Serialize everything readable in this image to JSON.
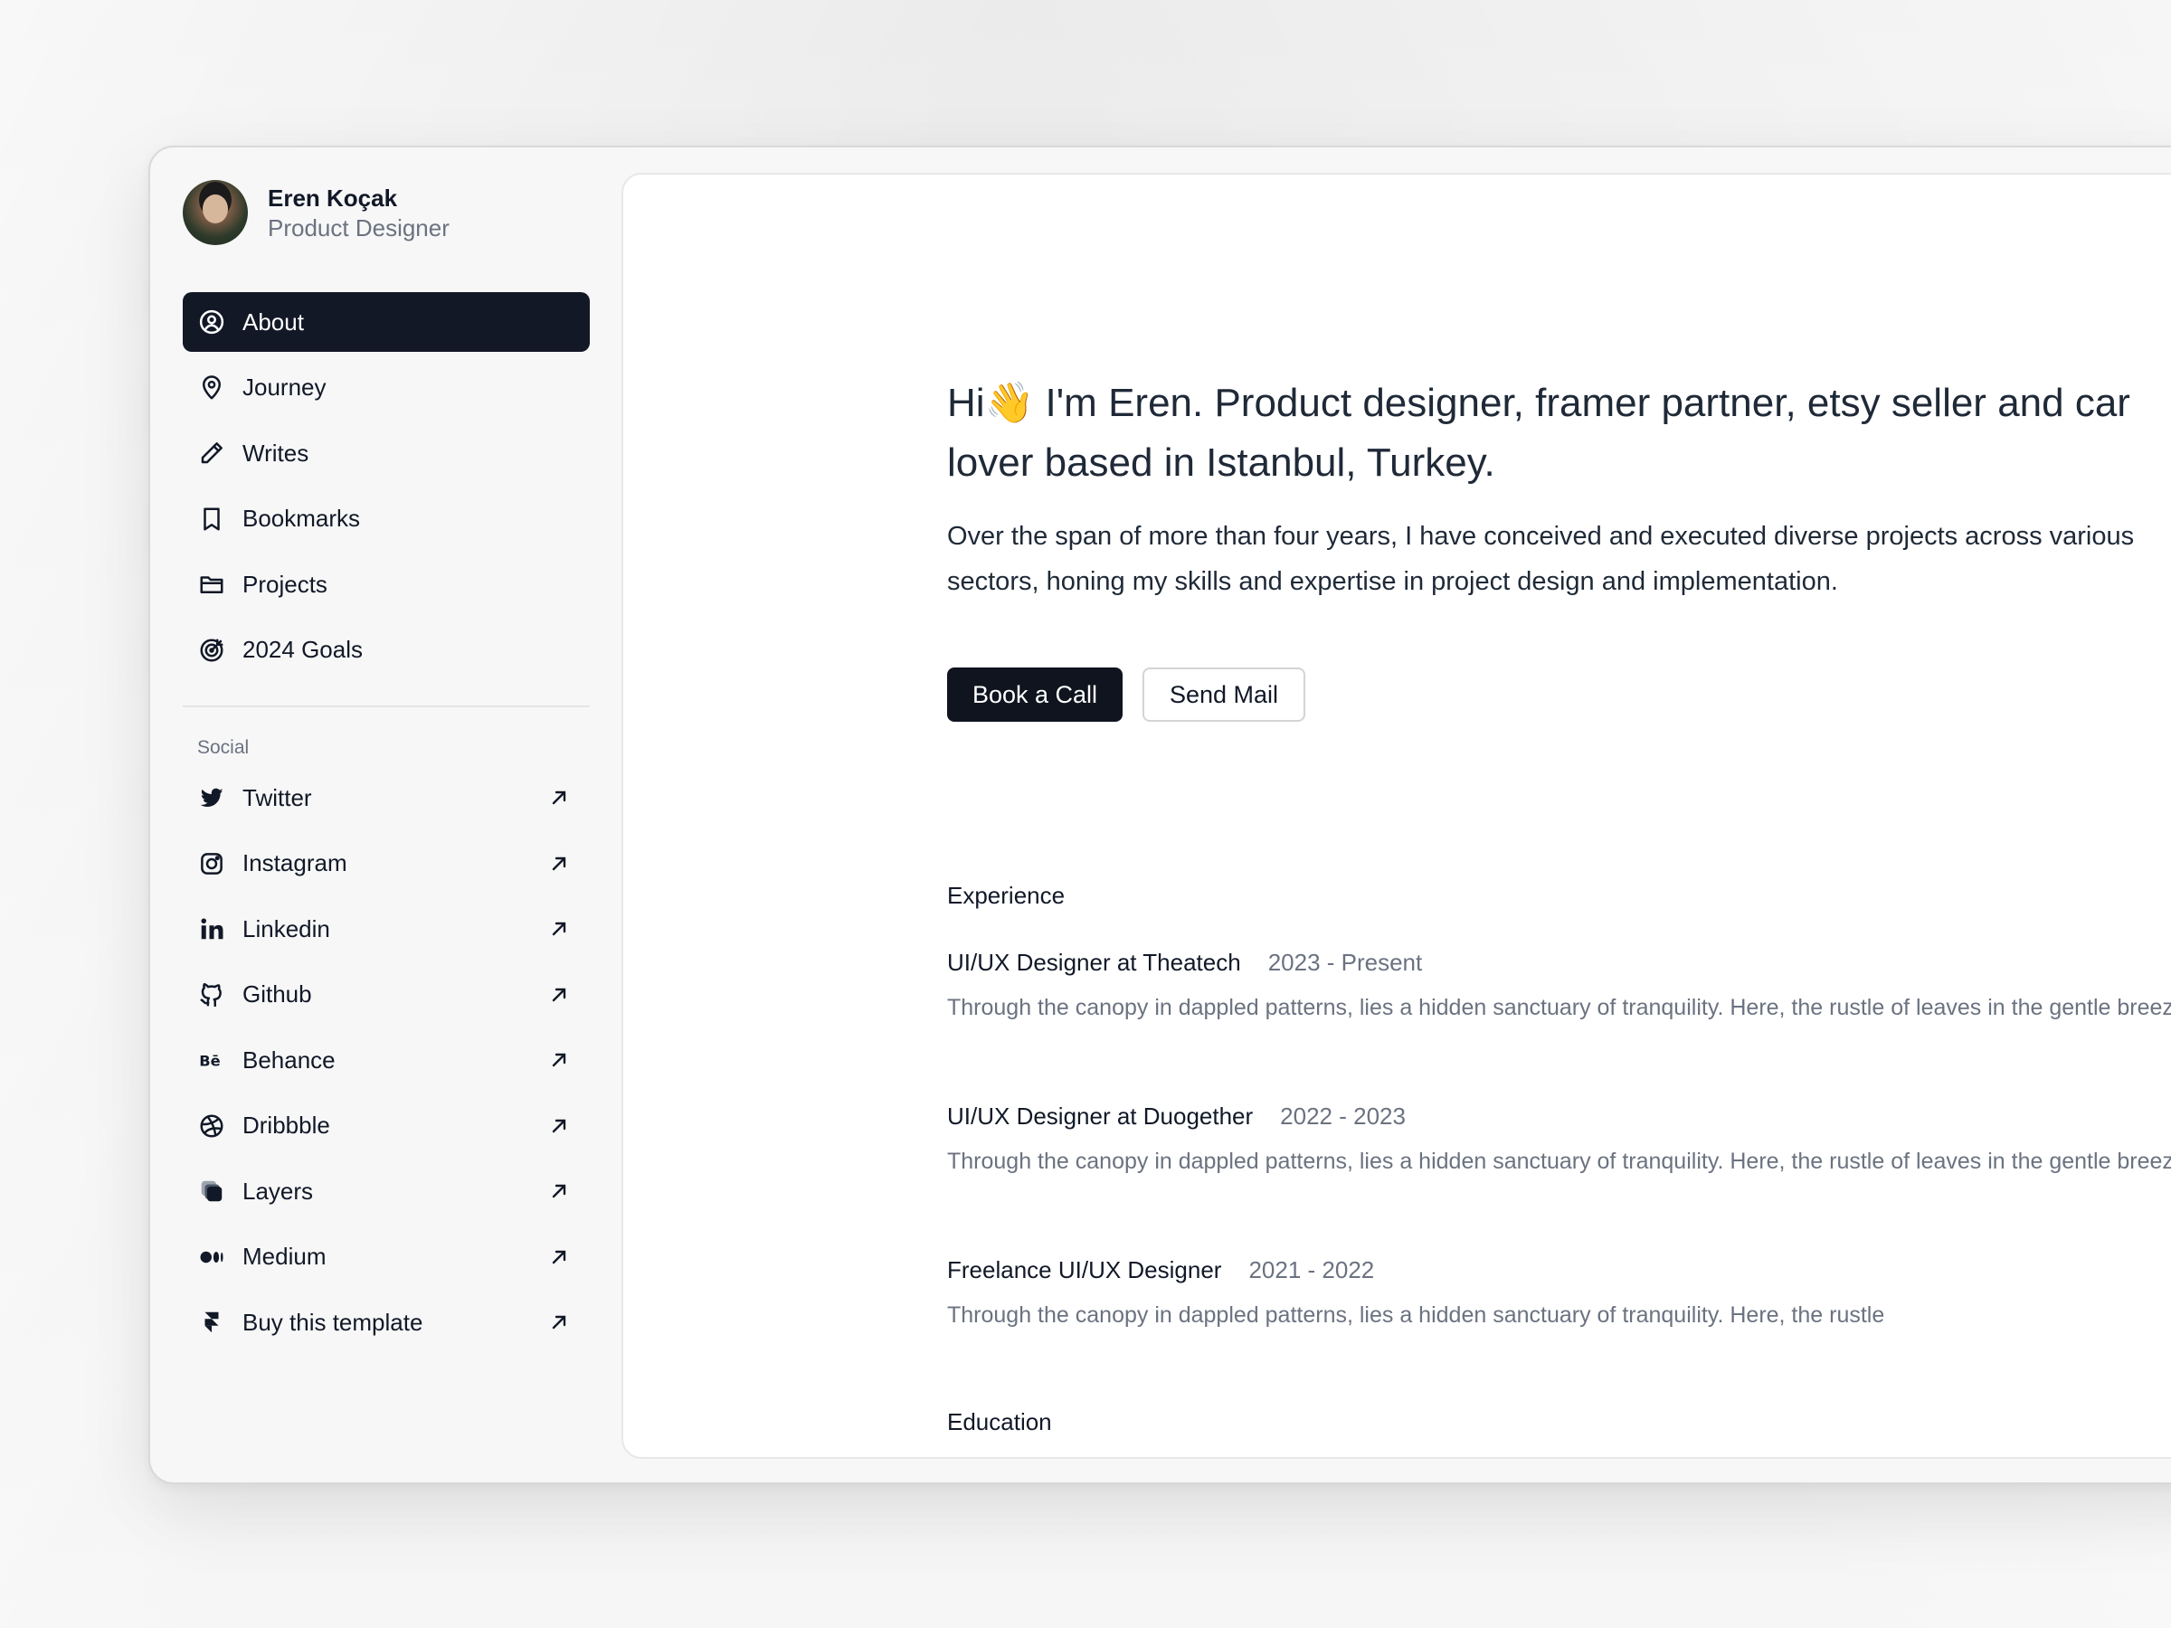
{
  "profile": {
    "name": "Eren Koçak",
    "role": "Product Designer"
  },
  "nav": {
    "items": [
      {
        "label": "About",
        "icon": "user-circle-icon",
        "active": true
      },
      {
        "label": "Journey",
        "icon": "map-pin-icon"
      },
      {
        "label": "Writes",
        "icon": "pencil-icon"
      },
      {
        "label": "Bookmarks",
        "icon": "bookmark-icon"
      },
      {
        "label": "Projects",
        "icon": "folder-icon"
      },
      {
        "label": "2024 Goals",
        "icon": "target-icon"
      }
    ]
  },
  "social": {
    "label": "Social",
    "items": [
      {
        "label": "Twitter",
        "icon": "twitter-icon"
      },
      {
        "label": "Instagram",
        "icon": "instagram-icon"
      },
      {
        "label": "Linkedin",
        "icon": "linkedin-icon"
      },
      {
        "label": "Github",
        "icon": "github-icon"
      },
      {
        "label": "Behance",
        "icon": "behance-icon"
      },
      {
        "label": "Dribbble",
        "icon": "dribbble-icon"
      },
      {
        "label": "Layers",
        "icon": "layers-icon"
      },
      {
        "label": "Medium",
        "icon": "medium-icon"
      },
      {
        "label": "Buy this template",
        "icon": "framer-icon"
      }
    ]
  },
  "hero": {
    "headline": "Hi👋 I'm Eren. Product designer, framer partner, etsy seller and car lover based in Istanbul, Turkey.",
    "intro": "Over the span of more than four years, I have conceived and executed diverse projects across various sectors, honing my skills and expertise in project design and implementation.",
    "primary_button": "Book a Call",
    "secondary_button": "Send Mail"
  },
  "experience": {
    "title": "Experience",
    "jobs": [
      {
        "title": "UI/UX Designer at Theatech",
        "years": "2023 - Present",
        "description": "Through the canopy in dappled patterns, lies a hidden sanctuary of tranquility. Here, the rustle of leaves in the gentle breeze"
      },
      {
        "title": "UI/UX Designer at Duogether",
        "years": "2022 - 2023",
        "description": "Through the canopy in dappled patterns, lies a hidden sanctuary of tranquility. Here, the rustle of leaves in the gentle breeze"
      },
      {
        "title": "Freelance UI/UX Designer",
        "years": "2021 - 2022",
        "description": "Through the canopy in dappled patterns, lies a hidden sanctuary of tranquility. Here, the rustle"
      }
    ]
  },
  "education": {
    "title": "Education"
  },
  "colors": {
    "active_nav_bg": "#121826",
    "primary_button_bg": "#0f141f",
    "text_primary": "#111827",
    "text_muted": "#6b7280"
  }
}
